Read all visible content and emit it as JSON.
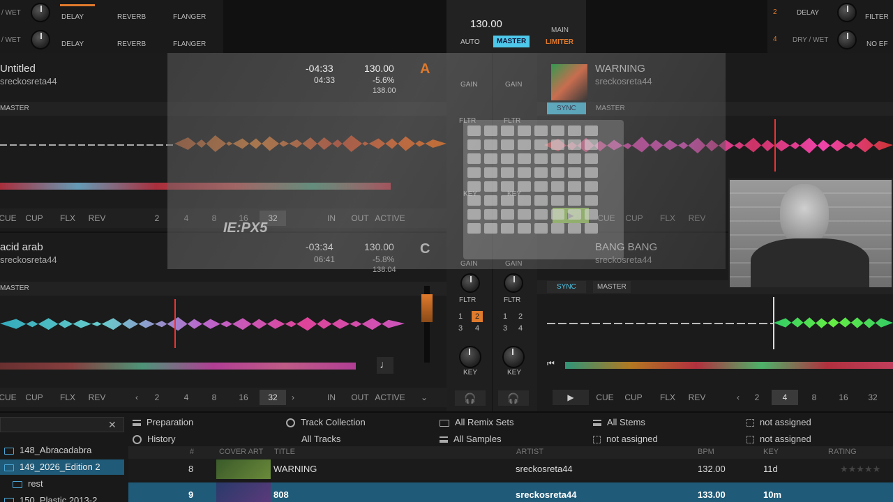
{
  "fx_top": {
    "row1": {
      "wet": "/ WET",
      "slot1": "DELAY",
      "slot2": "REVERB",
      "slot3": "FLANGER"
    },
    "row2": {
      "wet": "/ WET",
      "slot1": "DELAY",
      "slot2": "REVERB",
      "slot3": "FLANGER"
    },
    "right_row1": {
      "num": "2",
      "slot1": "DELAY",
      "slot2": "FILTER"
    },
    "right_row2": {
      "num": "4",
      "wet": "DRY / WET",
      "slot2": "NO EF"
    }
  },
  "master_section": {
    "bpm": "130.00",
    "auto": "AUTO",
    "master": "MASTER",
    "limiter": "LIMITER",
    "main": "MAIN"
  },
  "deck_a": {
    "title": "Untitled",
    "artist": "sreckosreta44",
    "time_remaining": "-04:33",
    "time_total": "04:33",
    "bpm": "130.00",
    "pitch": "-5.6%",
    "orig_bpm": "138.00",
    "letter": "A",
    "master": "MASTER",
    "buttons": [
      "CUE",
      "CUP",
      "FLX",
      "REV"
    ],
    "loops": [
      "2",
      "4",
      "8",
      "16",
      "32"
    ],
    "loop_ctrl": [
      "IN",
      "OUT",
      "ACTIVE"
    ],
    "gain": "GAIN",
    "filter": "FLTR",
    "key": "KEY"
  },
  "deck_b": {
    "title": "WARNING",
    "artist": "sreckosreta44",
    "sync": "SYNC",
    "master": "MASTER",
    "buttons": [
      "CUE",
      "CUP",
      "FLX",
      "REV"
    ],
    "gain": "GAIN",
    "filter": "FLTR",
    "key": "KEY"
  },
  "deck_c": {
    "title": "acid arab",
    "artist": "sreckosreta44",
    "time_remaining": "-03:34",
    "time_total": "06:41",
    "bpm": "130.00",
    "pitch": "-5.8%",
    "orig_bpm": "138.04",
    "letter": "C",
    "master": "MASTER",
    "buttons": [
      "CUE",
      "CUP",
      "FLX",
      "REV"
    ],
    "loops": [
      "2",
      "4",
      "8",
      "16",
      "32"
    ],
    "loop_ctrl": [
      "IN",
      "OUT",
      "ACTIVE"
    ],
    "gain": "GAIN",
    "filter": "FLTR",
    "key": "KEY"
  },
  "deck_d": {
    "title": "BANG BANG",
    "artist": "sreckosreta44",
    "sync": "SYNC",
    "master": "MASTER",
    "buttons": [
      "CUE",
      "CUP",
      "FLX",
      "REV"
    ],
    "loops": [
      "2",
      "4",
      "8",
      "16",
      "32"
    ],
    "gain": "GAIN",
    "filter": "FLTR",
    "key": "KEY"
  },
  "mixer_pads": {
    "left": [
      "1",
      "2",
      "3",
      "4"
    ],
    "right": [
      "1",
      "2",
      "3",
      "4"
    ]
  },
  "browser": {
    "tree": [
      "148_Abracadabra",
      "149_2026_Edition 2",
      "rest",
      "150_Plastic 2013-2"
    ],
    "favorites": [
      {
        "label": "Preparation",
        "icon": "list-icon"
      },
      {
        "label": "History",
        "icon": "clock-icon"
      },
      {
        "label": "Track Collection",
        "icon": "disc-icon"
      },
      {
        "label": "All Tracks",
        "icon": "none"
      },
      {
        "label": "All Remix Sets",
        "icon": "folder-icon"
      },
      {
        "label": "All Samples",
        "icon": "list-icon"
      },
      {
        "label": "All Stems",
        "icon": "list-icon"
      },
      {
        "label": "not assigned",
        "icon": "box-icon"
      },
      {
        "label": "not assigned",
        "icon": "box-icon"
      },
      {
        "label": "not assigned",
        "icon": "box-icon"
      }
    ],
    "columns": {
      "num": "#",
      "cover": "COVER ART",
      "title": "TITLE",
      "artist": "ARTIST",
      "bpm": "BPM",
      "key": "KEY",
      "rating": "RATING"
    },
    "rows": [
      {
        "num": "8",
        "title": "WARNING",
        "artist": "sreckosreta44",
        "bpm": "132.00",
        "key": "11d"
      },
      {
        "num": "9",
        "title": "808",
        "artist": "sreckosreta44",
        "bpm": "133.00",
        "key": "10m"
      }
    ]
  },
  "overlay": {
    "brand": "IE:PX5"
  }
}
